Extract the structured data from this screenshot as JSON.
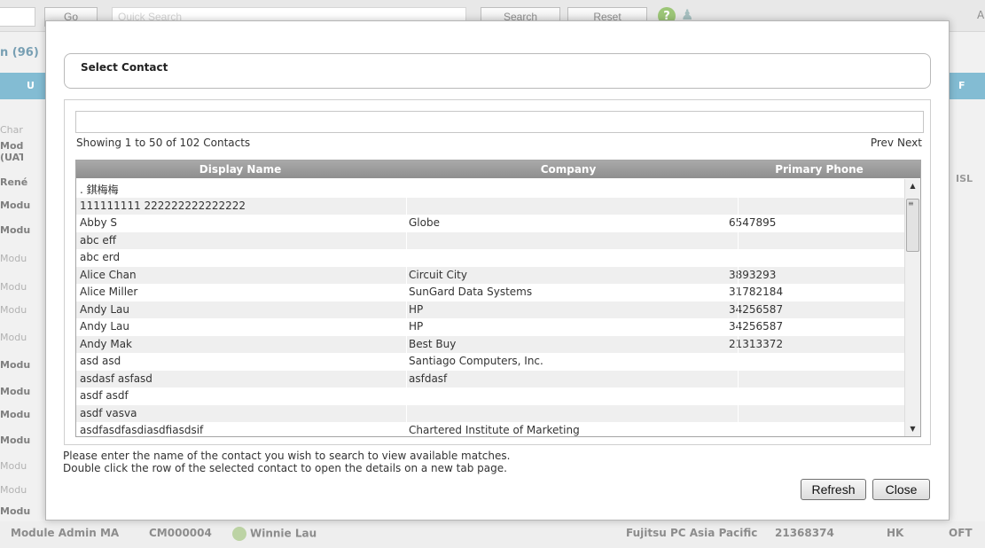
{
  "toolbar": {
    "go_label": "Go",
    "quick_search_placeholder": "Quick Search",
    "search_label": "Search",
    "reset_label": "Reset",
    "top_right_char": "A"
  },
  "background": {
    "count_label": "n (96)",
    "header_cells": [
      "U",
      "F"
    ],
    "side_rows": [
      {
        "text": "Char",
        "bold": false
      },
      {
        "text": "Modu (UAT",
        "bold": true
      },
      {
        "text": "René",
        "bold": true
      },
      {
        "text": "Modu",
        "bold": true
      },
      {
        "text": "Modu",
        "bold": true
      },
      {
        "text": "Modu",
        "bold": false
      },
      {
        "text": "Modu",
        "bold": false
      },
      {
        "text": "Modu",
        "bold": false
      },
      {
        "text": "Modu",
        "bold": false
      },
      {
        "text": "Modu",
        "bold": true
      },
      {
        "text": "Modu",
        "bold": true
      },
      {
        "text": "Modu",
        "bold": true
      },
      {
        "text": "Modu",
        "bold": true
      },
      {
        "text": "Modu",
        "bold": false
      },
      {
        "text": "Modu",
        "bold": false
      },
      {
        "text": "Modu",
        "bold": true
      }
    ],
    "right_fragment": "ISL",
    "bottom_row": {
      "module": "Module Admin MA",
      "code": "CM000004",
      "person": "Winnie Lau",
      "company": "Fujitsu PC Asia Pacific",
      "phone": "21368374",
      "country": "HK",
      "extra": "OFT"
    }
  },
  "dialog": {
    "title": "Select Contact",
    "search_value": "",
    "showing": "Showing 1 to 50 of 102 Contacts",
    "prev_label": "Prev",
    "next_label": "Next",
    "columns": [
      "Display Name",
      "Company",
      "Primary Phone"
    ],
    "rows": [
      [
        ". 錤梅梅",
        "",
        ""
      ],
      [
        "111111111 222222222222222",
        "",
        ""
      ],
      [
        "Abby S",
        "Globe",
        "6547895"
      ],
      [
        "abc eff",
        "",
        ""
      ],
      [
        "abc erd",
        "",
        ""
      ],
      [
        "Alice Chan",
        "Circuit City",
        "3893293"
      ],
      [
        "Alice Miller",
        "SunGard Data Systems",
        "31782184"
      ],
      [
        "Andy Lau",
        "HP",
        "34256587"
      ],
      [
        "Andy Lau",
        "HP",
        "34256587"
      ],
      [
        "Andy Mak",
        "Best Buy",
        "21313372"
      ],
      [
        "asd asd",
        "Santiago Computers, Inc.",
        ""
      ],
      [
        "asdasf asfasd",
        "asfdasf",
        ""
      ],
      [
        "asdf asdf",
        "",
        ""
      ],
      [
        "asdf vasva",
        "",
        ""
      ],
      [
        "asdfasdfasdiasdfiasdsif",
        "Chartered Institute of Marketing",
        ""
      ]
    ],
    "note_line1": "Please enter the name of the contact you wish to search to view available matches.",
    "note_line2": "Double click the row of the selected contact to open the details on a new tab page.",
    "refresh_label": "Refresh",
    "close_label": "Close"
  }
}
